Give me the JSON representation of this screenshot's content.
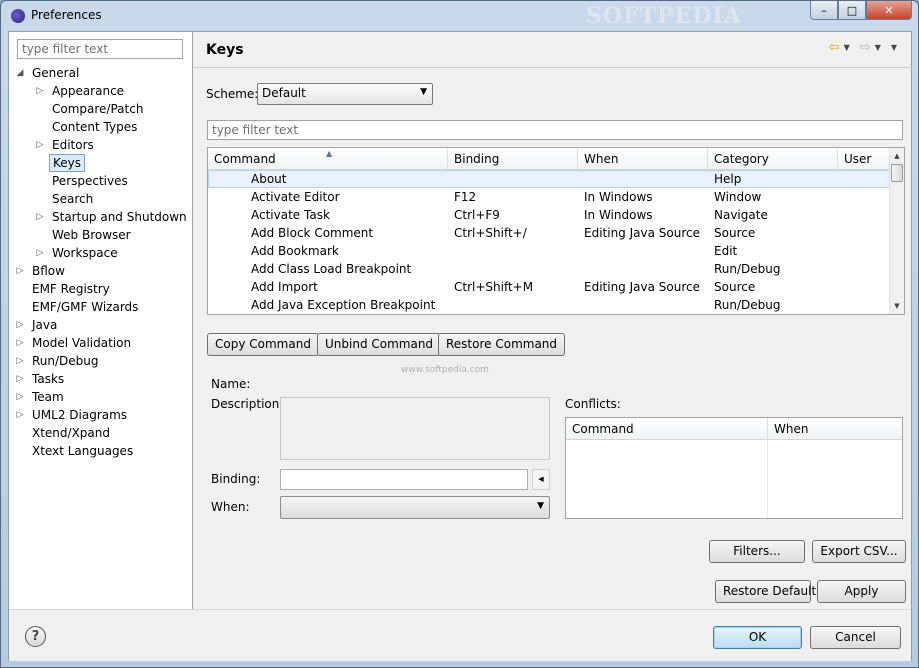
{
  "window": {
    "title": "Preferences",
    "watermark": "SOFTPEDIA",
    "minimize_glyph": "–",
    "maximize_glyph": "□",
    "close_glyph": "✕"
  },
  "sidebar": {
    "filter_placeholder": "type filter text",
    "items": [
      {
        "label": "General",
        "expanded": true,
        "level": 0,
        "twisty": "◢"
      },
      {
        "label": "Appearance",
        "level": 1,
        "twisty": "▷"
      },
      {
        "label": "Compare/Patch",
        "level": 1,
        "twisty": ""
      },
      {
        "label": "Content Types",
        "level": 1,
        "twisty": ""
      },
      {
        "label": "Editors",
        "level": 1,
        "twisty": "▷"
      },
      {
        "label": "Keys",
        "level": 1,
        "twisty": "",
        "selected": true
      },
      {
        "label": "Perspectives",
        "level": 1,
        "twisty": ""
      },
      {
        "label": "Search",
        "level": 1,
        "twisty": ""
      },
      {
        "label": "Startup and Shutdown",
        "level": 1,
        "twisty": "▷"
      },
      {
        "label": "Web Browser",
        "level": 1,
        "twisty": ""
      },
      {
        "label": "Workspace",
        "level": 1,
        "twisty": "▷"
      },
      {
        "label": "Bflow",
        "level": 0,
        "twisty": "▷"
      },
      {
        "label": "EMF Registry",
        "level": 0,
        "twisty": ""
      },
      {
        "label": "EMF/GMF Wizards",
        "level": 0,
        "twisty": ""
      },
      {
        "label": "Java",
        "level": 0,
        "twisty": "▷"
      },
      {
        "label": "Model Validation",
        "level": 0,
        "twisty": "▷"
      },
      {
        "label": "Run/Debug",
        "level": 0,
        "twisty": "▷"
      },
      {
        "label": "Tasks",
        "level": 0,
        "twisty": "▷"
      },
      {
        "label": "Team",
        "level": 0,
        "twisty": "▷"
      },
      {
        "label": "UML2 Diagrams",
        "level": 0,
        "twisty": "▷"
      },
      {
        "label": "Xtend/Xpand",
        "level": 0,
        "twisty": ""
      },
      {
        "label": "Xtext Languages",
        "level": 0,
        "twisty": ""
      }
    ]
  },
  "page": {
    "title": "Keys",
    "nav": {
      "back": "⇦",
      "forward": "⇨",
      "dropdown": "▼",
      "menu": "▼"
    },
    "scheme_label": "Scheme:",
    "scheme_value": "Default",
    "filter_placeholder": "type filter text",
    "table": {
      "columns": [
        "Command",
        "Binding",
        "When",
        "Category",
        "User"
      ],
      "sort_caret": "▲",
      "rows": [
        {
          "command": "About",
          "binding": "",
          "when": "",
          "category": "Help",
          "selected": true
        },
        {
          "command": "Activate Editor",
          "binding": "F12",
          "when": "In Windows",
          "category": "Window"
        },
        {
          "command": "Activate Task",
          "binding": "Ctrl+F9",
          "when": "In Windows",
          "category": "Navigate"
        },
        {
          "command": "Add Block Comment",
          "binding": "Ctrl+Shift+/",
          "when": "Editing Java Source",
          "category": "Source"
        },
        {
          "command": "Add Bookmark",
          "binding": "",
          "when": "",
          "category": "Edit"
        },
        {
          "command": "Add Class Load Breakpoint",
          "binding": "",
          "when": "",
          "category": "Run/Debug"
        },
        {
          "command": "Add Import",
          "binding": "Ctrl+Shift+M",
          "when": "Editing Java Source",
          "category": "Source"
        },
        {
          "command": "Add Java Exception Breakpoint",
          "binding": "",
          "when": "",
          "category": "Run/Debug"
        }
      ]
    },
    "buttons": {
      "copy_command": "Copy Command",
      "unbind_command": "Unbind Command",
      "restore_command": "Restore Command",
      "filters": "Filters...",
      "export_csv": "Export CSV...",
      "restore_defaults": "Restore Defaults",
      "apply": "Apply"
    },
    "details": {
      "name_label": "Name:",
      "description_label": "Description:",
      "binding_label": "Binding:",
      "when_label": "When:",
      "binding_button_glyph": "◀",
      "when_arrow": "▼"
    },
    "conflicts": {
      "label": "Conflicts:",
      "columns": [
        "Command",
        "When"
      ]
    },
    "softpedia_mark": "www.softpedia.com"
  },
  "footer": {
    "help_glyph": "?",
    "ok": "OK",
    "cancel": "Cancel"
  }
}
